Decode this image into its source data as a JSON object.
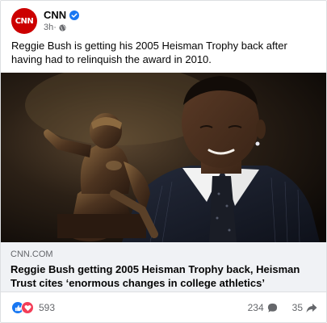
{
  "post": {
    "page_name": "CNN",
    "avatar_text": "CNN",
    "time": "3h",
    "time_separator": "·",
    "text": "Reggie Bush is getting his 2005 Heisman Trophy back after having had to relinquish the award in 2010.",
    "verified_icon": "verified-badge-icon",
    "audience_icon": "globe-icon"
  },
  "link": {
    "domain": "CNN.COM",
    "headline": "Reggie Bush getting 2005 Heisman Trophy back, Heisman Trust cites ‘enormous changes in college athletics’"
  },
  "stats": {
    "reactions": "593",
    "comments": "234",
    "shares": "35",
    "reaction_icons": [
      "like-icon",
      "love-icon"
    ],
    "comment_icon": "comment-bubble-icon",
    "share_icon": "share-arrow-icon"
  },
  "colors": {
    "brand_red": "#cc0000",
    "like_blue": "#1877f2",
    "love_red": "#f33e58",
    "verified_blue": "#1877f2"
  }
}
